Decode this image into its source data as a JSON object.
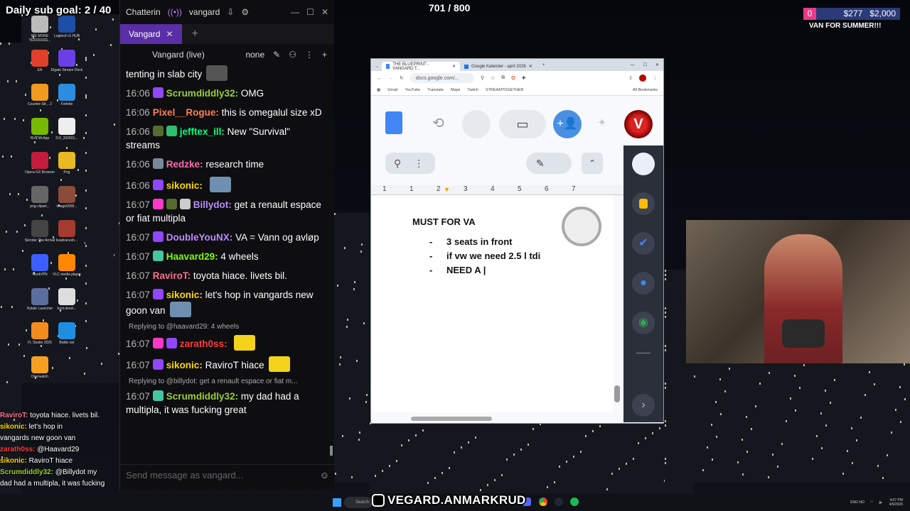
{
  "overlay": {
    "sub_goal": "Daily sub goal: 2 / 40",
    "viewer_goal": "701 / 800",
    "donation_zero": "0",
    "donation_amount": "$277",
    "donation_goal": "$2,000",
    "summer_text": "VAN FOR SUMMER!!!"
  },
  "desktop_icons": [
    {
      "label": "WE MORE YESSSSSS...",
      "color": "#bbbbbb"
    },
    {
      "label": "Logitech G HUB",
      "color": "#1e4fa8"
    },
    {
      "label": "EA",
      "color": "#e2402b"
    },
    {
      "label": "Elgato Stream Deck",
      "color": "#6a3fe6"
    },
    {
      "label": "Counter-Str... 2",
      "color": "#f09a20"
    },
    {
      "label": "Fortnite",
      "color": "#2b8de0"
    },
    {
      "label": "NVIDIA App",
      "color": "#76b900"
    },
    {
      "label": "DJI_202601...",
      "color": "#eeeeee"
    },
    {
      "label": "Opera GX Browser",
      "color": "#c31c3d"
    },
    {
      "label": "Pog",
      "color": "#e8b923"
    },
    {
      "label": "png-clipart...",
      "color": "#666666"
    },
    {
      "label": "image0000...",
      "color": "#8a4b3a"
    },
    {
      "label": "Slender The Arrival",
      "color": "#444444"
    },
    {
      "label": "kvadrat-esh...",
      "color": "#a33b2e"
    },
    {
      "label": "NordVPN",
      "color": "#3e5fff"
    },
    {
      "label": "VLC media player",
      "color": "#ff8800"
    },
    {
      "label": "Hytale Launcher",
      "color": "#5a6fa0"
    },
    {
      "label": "host.devel...",
      "color": "#dddddd"
    },
    {
      "label": "FL Studio 2025",
      "color": "#f18c1d"
    },
    {
      "label": "Battle.net",
      "color": "#1f8ee0"
    },
    {
      "label": "Overwatch",
      "color": "#f5a021"
    }
  ],
  "chat": {
    "window_title": "Chatterin",
    "user": "vangard",
    "tab_label": "Vangard",
    "channel_header": "Vangard (live)",
    "mode": "none",
    "input_placeholder": "Send message as vangard...",
    "messages": [
      {
        "ts": "",
        "user": "",
        "user_color": "#ffffff",
        "text": "tenting in slab city",
        "badges": [],
        "emote": "#555555"
      },
      {
        "ts": "16:06",
        "user": "Scrumdiddly32:",
        "user_color": "#9acd32",
        "text": "OMG",
        "badges": [
          "#9146ff"
        ]
      },
      {
        "ts": "16:06",
        "user": "Pixel__Rogue:",
        "user_color": "#ff7f50",
        "text": "this is omegalul size xD",
        "badges": []
      },
      {
        "ts": "16:06",
        "user": "jefftex_ill:",
        "user_color": "#00ff7f",
        "text": "New \"Survival\" streams",
        "badges": [
          "#556b2f",
          "#2fbf71"
        ]
      },
      {
        "ts": "16:06",
        "user": "Redzke:",
        "user_color": "#ff69b4",
        "text": "research time",
        "badges": [
          "#778899"
        ]
      },
      {
        "ts": "16:06",
        "user": "sikonic:",
        "user_color": "#ffd700",
        "text": "",
        "badges": [
          "#9146ff"
        ],
        "emote": "#6f8fb0"
      },
      {
        "ts": "16:07",
        "user": "Billydot:",
        "user_color": "#b98cff",
        "text": "get a renault espace or fiat multipla",
        "badges": [
          "#ff38c8",
          "#556b2f",
          "#cccccc"
        ]
      },
      {
        "ts": "16:07",
        "user": "DoubleYouNX:",
        "user_color": "#b98cff",
        "text": "VA = Vann og avløp",
        "badges": [
          "#9146ff"
        ]
      },
      {
        "ts": "16:07",
        "user": "Haavard29:",
        "user_color": "#7cfc00",
        "text": "4 wheels",
        "badges": [
          "#45c5a0"
        ]
      },
      {
        "ts": "16:07",
        "user": "RaviroT:",
        "user_color": "#ff6f91",
        "text": "toyota hiace. livets bil.",
        "badges": []
      },
      {
        "ts": "16:07",
        "user": "sikonic:",
        "user_color": "#ffd700",
        "text": "let's hop in vangards new goon van",
        "badges": [
          "#9146ff"
        ],
        "emote": "#6f8fb0"
      },
      {
        "reply": "Replying to @haavard29: 4 wheels",
        "ts": "16:07",
        "user": "zarath0ss:",
        "user_color": "#ff3b3b",
        "text": "",
        "badges": [
          "#ff38c8",
          "#9146ff"
        ],
        "emote": "#f2d21b"
      },
      {
        "ts": "16:07",
        "user": "sikonic:",
        "user_color": "#ffd700",
        "text": "RaviroT hiace",
        "badges": [
          "#9146ff"
        ],
        "emote": "#f2d21b"
      },
      {
        "reply": "Replying to @billydot: get a renault espace or fiat m...",
        "ts": "16:07",
        "user": "Scrumdiddly32:",
        "user_color": "#9acd32",
        "text": "my dad had a multipla, it was fucking great",
        "badges": [
          "#45c5a0"
        ]
      }
    ]
  },
  "browser": {
    "tab1": "THE BLUEPRINT - VANGARD T...",
    "tab2": "Google Kalender - april 2026",
    "url": "docs.google.com/...",
    "bookmarks": [
      "Gmail",
      "YouTube",
      "Translate",
      "Maps",
      "Twitch",
      "STREAMTOGETHER"
    ],
    "all_bookmarks": "All Bookmarks",
    "ruler_marks": [
      "1",
      "1",
      "2",
      "3",
      "4",
      "5",
      "6",
      "7"
    ]
  },
  "doc": {
    "title": "MUST FOR VA",
    "items": [
      "3 seats in front",
      "if vw we need 2.5 l tdi",
      "NEED A |"
    ]
  },
  "overlay_chat": [
    {
      "user": "RaviroT:",
      "text": "toyota hiace. livets bil.",
      "color": "#ff6f91"
    },
    {
      "user": "sikonic:",
      "text": "let's hop in",
      "color": "#ffd700"
    },
    {
      "user": "",
      "text": "vangards new goon van",
      "color": "#ffffff"
    },
    {
      "user": "zarath0ss:",
      "text": "@Haavard29",
      "color": "#ff3b3b"
    },
    {
      "user": "sikonic:",
      "text": "RaviroT hiace",
      "color": "#ffd700"
    },
    {
      "user": "Scrumdiddly32:",
      "text": "@Billydot my",
      "color": "#9acd32"
    },
    {
      "user": "",
      "text": "dad had a multipla, it was fucking",
      "color": "#ffffff"
    }
  ],
  "taskbar": {
    "search": "Search",
    "instagram": "VEGARD.ANMARKRUD",
    "lang": "ENG NO",
    "time": "4:07 PM",
    "date": "4/6/2026"
  }
}
